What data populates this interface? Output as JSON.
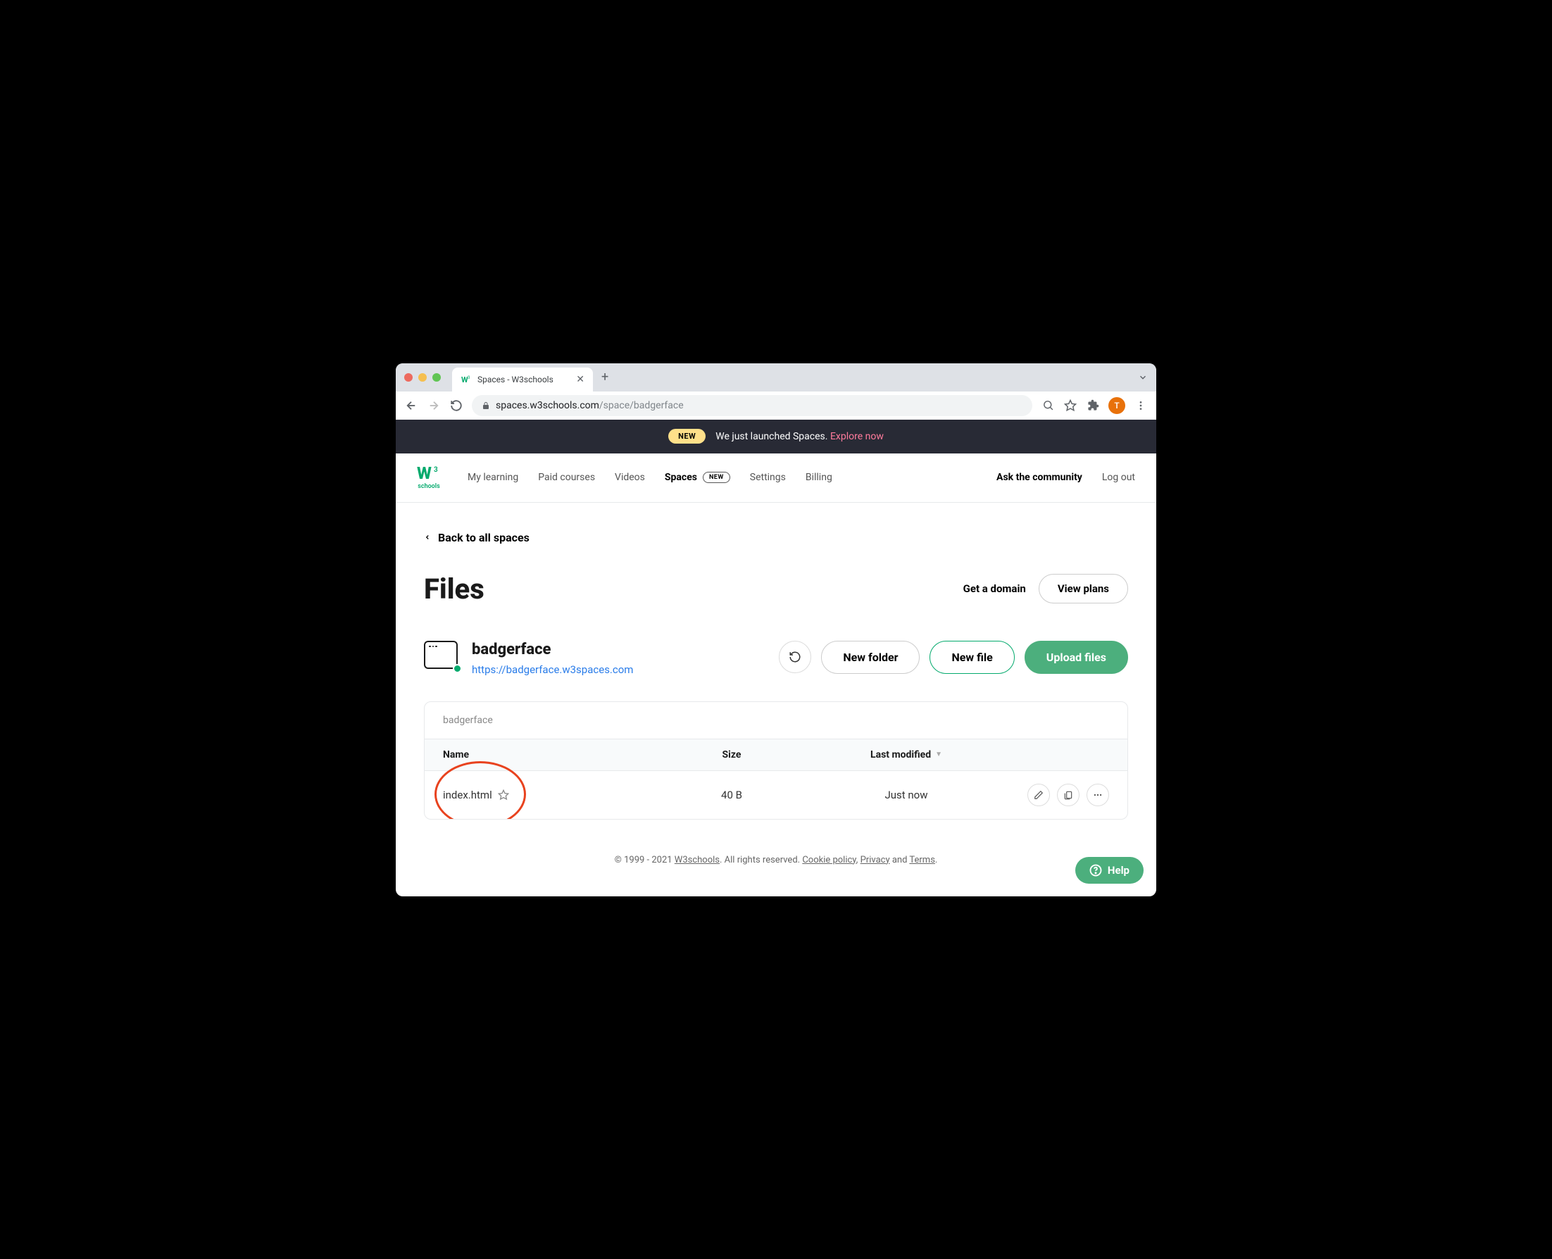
{
  "browser": {
    "tab_title": "Spaces - W3schools",
    "url_domain": "spaces.w3schools.com",
    "url_path": "/space/badgerface",
    "avatar_letter": "T"
  },
  "announcement": {
    "badge": "NEW",
    "text": "We just launched Spaces.",
    "link": "Explore now"
  },
  "topnav": {
    "logo_main": "W",
    "logo_sup": "3",
    "logo_sub": "schools",
    "links": {
      "my_learning": "My learning",
      "paid_courses": "Paid courses",
      "videos": "Videos",
      "spaces": "Spaces",
      "spaces_badge": "NEW",
      "settings": "Settings",
      "billing": "Billing",
      "ask": "Ask the community",
      "logout": "Log out"
    }
  },
  "page": {
    "back_link": "Back to all spaces",
    "title": "Files",
    "get_domain": "Get a domain",
    "view_plans": "View plans"
  },
  "space": {
    "name": "badgerface",
    "url": "https://badgerface.w3spaces.com",
    "new_folder": "New folder",
    "new_file": "New file",
    "upload": "Upload files"
  },
  "files": {
    "breadcrumb": "badgerface",
    "columns": {
      "name": "Name",
      "size": "Size",
      "modified": "Last modified"
    },
    "rows": [
      {
        "name": "index.html",
        "size": "40 B",
        "modified": "Just now"
      }
    ]
  },
  "footer": {
    "copyright": "© 1999 - 2021 ",
    "brand": "W3schools",
    "rights": ". All rights reserved. ",
    "cookie": "Cookie policy",
    "sep1": ", ",
    "privacy": "Privacy",
    "and": " and ",
    "terms": "Terms",
    "dot": "."
  },
  "help": {
    "label": "Help"
  }
}
